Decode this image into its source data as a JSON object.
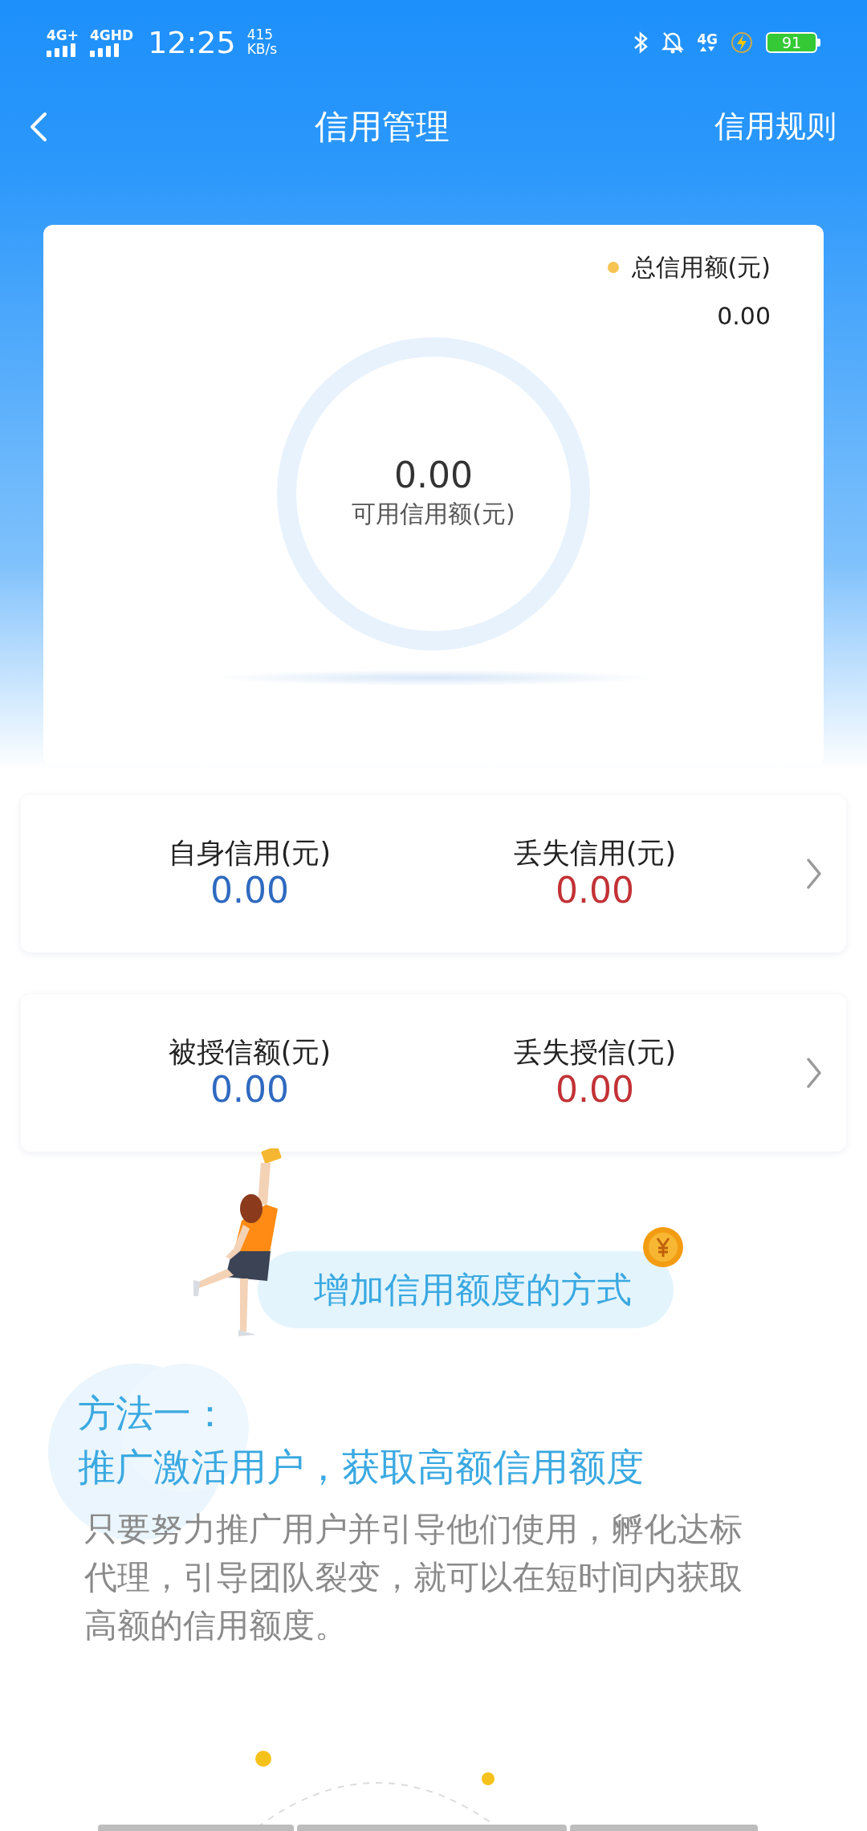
{
  "status_bar": {
    "network_1": "4G+",
    "network_2": "4GHD",
    "time": "12:25",
    "speed_value": "415",
    "speed_unit": "KB/s",
    "network_3": "4G",
    "battery": "91"
  },
  "header": {
    "title": "信用管理",
    "action": "信用规则"
  },
  "overview": {
    "legend": {
      "label": "总信用额(元)",
      "color": "#f5c451"
    },
    "total_value": "0.00",
    "available_value": "0.00",
    "available_label": "可用信用额(元)"
  },
  "summary_cards": [
    {
      "items": [
        {
          "label": "自身信用(元)",
          "value": "0.00",
          "kind": "gain"
        },
        {
          "label": "丢失信用(元)",
          "value": "0.00",
          "kind": "loss"
        }
      ]
    },
    {
      "items": [
        {
          "label": "被授信额(元)",
          "value": "0.00",
          "kind": "gain"
        },
        {
          "label": "丢失授信(元)",
          "value": "0.00",
          "kind": "loss"
        }
      ]
    }
  ],
  "banner": {
    "title": "增加信用额度的方式"
  },
  "method": {
    "heading": "方法一：",
    "subheading": "推广激活用户，获取高额信用额度",
    "description": "只要努力推广用户并引导他们使用，孵化达标代理，引导团队裂变，就可以在短时间内获取高额的信用额度。"
  }
}
